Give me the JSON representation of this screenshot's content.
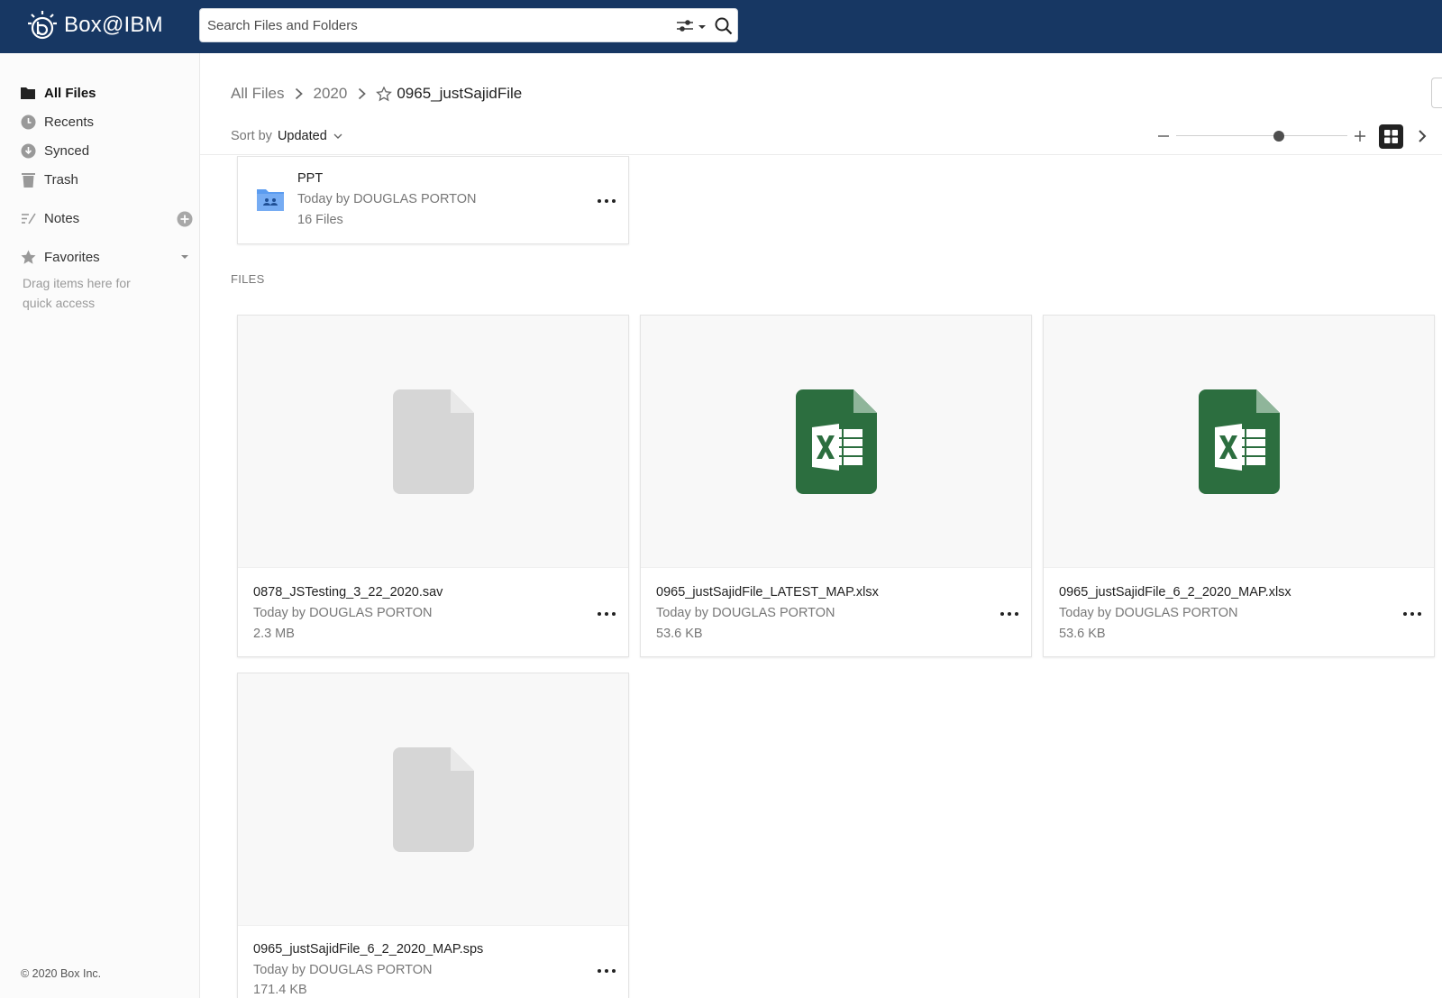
{
  "header": {
    "logo_text": "Box@IBM",
    "search_placeholder": "Search Files and Folders"
  },
  "sidebar": {
    "items": [
      {
        "label": "All Files",
        "icon": "folder-icon",
        "active": true
      },
      {
        "label": "Recents",
        "icon": "clock-icon"
      },
      {
        "label": "Synced",
        "icon": "synced-icon"
      },
      {
        "label": "Trash",
        "icon": "trash-icon"
      },
      {
        "label": "Notes",
        "icon": "notes-icon"
      },
      {
        "label": "Favorites",
        "icon": "star-icon"
      }
    ],
    "favorites_hint": "Drag items here for quick access",
    "copyright": "© 2020 Box Inc."
  },
  "breadcrumb": {
    "items": [
      "All Files",
      "2020"
    ],
    "current": "0965_justSajidFile"
  },
  "sort": {
    "label": "Sort by",
    "value": "Updated"
  },
  "zoom": {
    "level": 0.6
  },
  "folders": [
    {
      "name": "PPT",
      "meta": "Today by DOUGLAS PORTON",
      "count": "16 Files"
    }
  ],
  "files_section_label": "FILES",
  "files": [
    {
      "name": "0878_JSTesting_3_22_2020.sav",
      "meta": "Today by DOUGLAS PORTON",
      "size": "2.3 MB",
      "type": "generic"
    },
    {
      "name": "0965_justSajidFile_LATEST_MAP.xlsx",
      "meta": "Today by DOUGLAS PORTON",
      "size": "53.6 KB",
      "type": "excel"
    },
    {
      "name": "0965_justSajidFile_6_2_2020_MAP.xlsx",
      "meta": "Today by DOUGLAS PORTON",
      "size": "53.6 KB",
      "type": "excel"
    },
    {
      "name": "0965_justSajidFile_6_2_2020_MAP.sps",
      "meta": "Today by DOUGLAS PORTON",
      "size": "171.4 KB",
      "type": "generic"
    }
  ],
  "colors": {
    "header_bg": "#173763",
    "excel_green": "#2c6e3f",
    "generic_file": "#d6d6d6",
    "folder_blue": "#5b9cf0"
  }
}
